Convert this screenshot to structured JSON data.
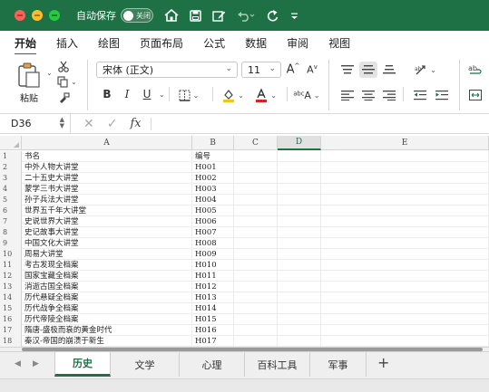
{
  "titlebar": {
    "autosave_label": "自动保存",
    "autosave_state": "关闭"
  },
  "ribbon_tabs": [
    "开始",
    "插入",
    "绘图",
    "页面布局",
    "公式",
    "数据",
    "审阅",
    "视图"
  ],
  "ribbon": {
    "paste_label": "粘贴",
    "font_name": "宋体 (正文)",
    "font_size": "11",
    "bold": "B",
    "italic": "I",
    "underline": "U"
  },
  "formula_bar": {
    "name_box": "D36",
    "fx_label": "fx"
  },
  "sheet": {
    "columns": [
      "A",
      "B",
      "C",
      "D",
      "E"
    ],
    "selected_column": "D",
    "rows": [
      {
        "num": "1",
        "a": "书名",
        "b": "编号"
      },
      {
        "num": "2",
        "a": "中外人物大讲堂",
        "b": "H001"
      },
      {
        "num": "3",
        "a": "二十五史大讲堂",
        "b": "H002"
      },
      {
        "num": "4",
        "a": "蒙学三书大讲堂",
        "b": "H003"
      },
      {
        "num": "5",
        "a": "孙子兵法大讲堂",
        "b": "H004"
      },
      {
        "num": "6",
        "a": "世界五千年大讲堂",
        "b": "H005"
      },
      {
        "num": "7",
        "a": "史说世界大讲堂",
        "b": "H006"
      },
      {
        "num": "8",
        "a": "史记故事大讲堂",
        "b": "H007"
      },
      {
        "num": "9",
        "a": "中国文化大讲堂",
        "b": "H008"
      },
      {
        "num": "10",
        "a": "周易大讲堂",
        "b": "H009"
      },
      {
        "num": "11",
        "a": "考古发现全档案",
        "b": "H010"
      },
      {
        "num": "12",
        "a": "国家宝藏全档案",
        "b": "H011"
      },
      {
        "num": "13",
        "a": "消逝古国全档案",
        "b": "H012"
      },
      {
        "num": "14",
        "a": "历代悬疑全档案",
        "b": "H013"
      },
      {
        "num": "15",
        "a": "历代战争全档案",
        "b": "H014"
      },
      {
        "num": "16",
        "a": "历代帝陵全档案",
        "b": "H015"
      },
      {
        "num": "17",
        "a": "隋唐-盛极而衰的黄金时代",
        "b": "H016"
      },
      {
        "num": "18",
        "a": "秦汉-帝国的崩溃于新生",
        "b": "H017"
      }
    ]
  },
  "sheet_tabs": [
    {
      "label": "历史",
      "active": true
    },
    {
      "label": "文学",
      "active": false
    },
    {
      "label": "心理",
      "active": false
    },
    {
      "label": "百科工具",
      "active": false
    },
    {
      "label": "军事",
      "active": false
    }
  ],
  "add_sheet_label": "+",
  "colors": {
    "brand": "#1e7145",
    "close": "#ff5f57",
    "minimize": "#febc2e",
    "maximize": "#28c840",
    "highlight_fill": "#f5c518",
    "font_color": "#e02020"
  },
  "icons": [
    "home-icon",
    "save-icon",
    "edit-icon",
    "undo-icon",
    "redo-icon",
    "customize-icon",
    "paste-icon",
    "cut-icon",
    "copy-icon",
    "format-painter-icon",
    "grow-font-icon",
    "shrink-font-icon",
    "border-icon",
    "fill-color-icon",
    "font-color-icon",
    "phonetic-icon",
    "align-top-icon",
    "align-middle-icon",
    "align-bottom-icon",
    "orientation-icon",
    "align-left-icon",
    "align-center-icon",
    "align-right-icon",
    "decrease-indent-icon",
    "increase-indent-icon",
    "wrap-text-icon",
    "merge-icon"
  ]
}
